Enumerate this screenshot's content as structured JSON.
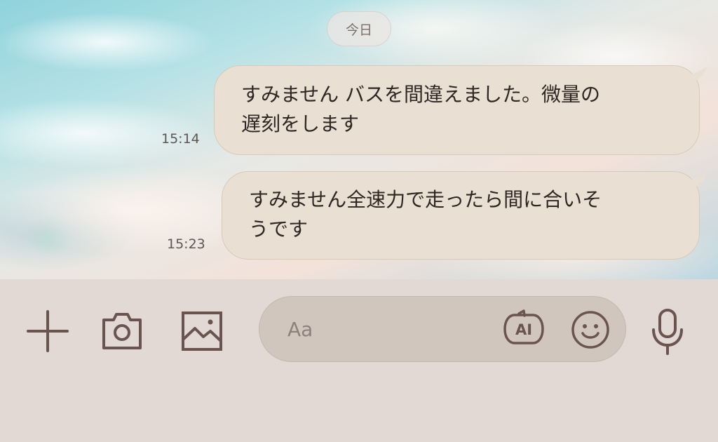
{
  "chat": {
    "date_label": "今日",
    "messages": [
      {
        "text": "すみません バスを間違えました。微量の\n遅刻をします",
        "time": "15:14"
      },
      {
        "text": "すみません全速力で走ったら間に合いそ\nうです",
        "time": "15:23"
      }
    ]
  },
  "input": {
    "placeholder": "Aa",
    "ai_label": "AI"
  },
  "icons": {
    "plus": "plus-icon",
    "camera": "camera-icon",
    "image": "image-icon",
    "ai": "ai-icon",
    "emoji": "emoji-icon",
    "mic": "mic-icon"
  },
  "colors": {
    "bubble": "#e9dfd2",
    "input_bar": "#e2d9d4",
    "icon": "#6a5450"
  }
}
